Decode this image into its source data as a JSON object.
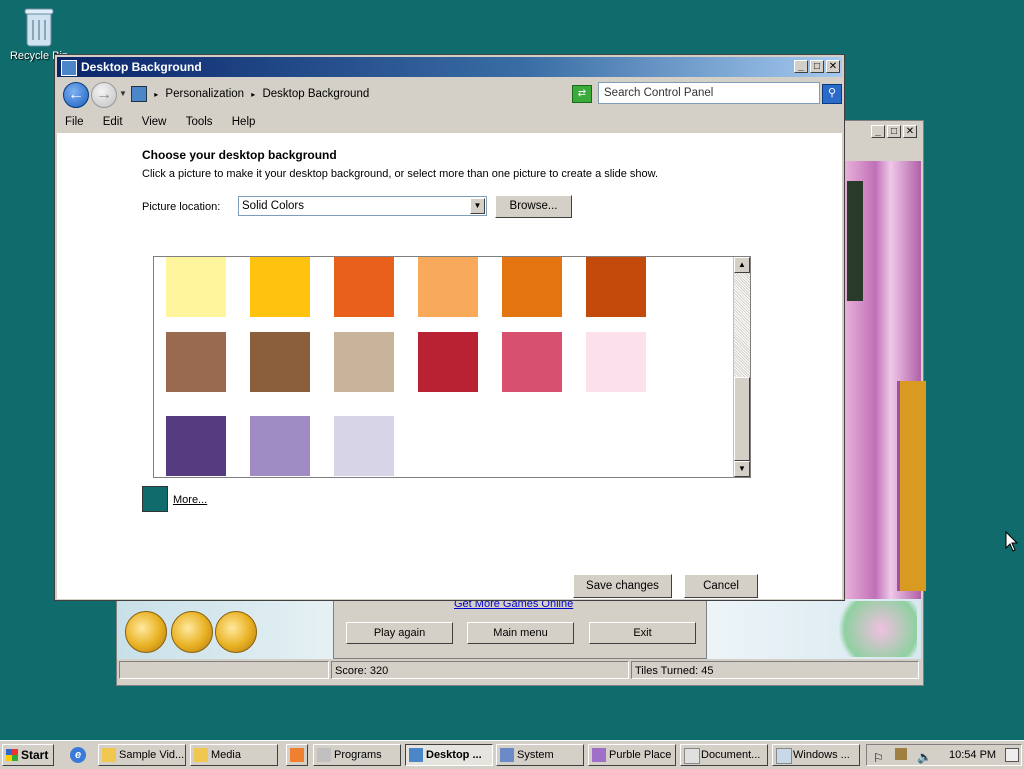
{
  "desktop": {
    "recycle_label": "Recycle Bin"
  },
  "window": {
    "title": "Desktop Background",
    "breadcrumb": [
      "Personalization",
      "Desktop Background"
    ],
    "search_placeholder": "Search Control Panel",
    "menu": [
      "File",
      "Edit",
      "View",
      "Tools",
      "Help"
    ],
    "heading": "Choose your desktop background",
    "description": "Click a picture to make it your desktop background, or select more than one picture to create a slide show.",
    "location_label": "Picture location:",
    "location_value": "Solid Colors",
    "browse_label": "Browse...",
    "more_label": "More...",
    "more_color": "#106c6c",
    "save_label": "Save changes",
    "cancel_label": "Cancel",
    "swatch_colors": [
      [
        "#fff59d",
        "#ffc30f",
        "#e8601c",
        "#f8aa5a",
        "#e57510",
        "#c44a0c"
      ],
      [
        "#9a6a50",
        "#8b5e3c",
        "#c8b49a",
        "#b82232",
        "#d85070",
        "#fce0ec"
      ],
      [
        "#553c80",
        "#a08cc4",
        "#d8d4e8"
      ]
    ]
  },
  "purble": {
    "link": "Get More Games Online",
    "buttons": [
      "Play again",
      "Main menu",
      "Exit"
    ],
    "score": "Score: 320",
    "tiles": "Tiles Turned: 45"
  },
  "taskbar": {
    "start": "Start",
    "items": [
      "Sample Vid...",
      "Media",
      "Programs",
      "Desktop ...",
      "System",
      "Purble Place",
      "Document...",
      "Windows ..."
    ],
    "clock": "10:54 PM"
  }
}
